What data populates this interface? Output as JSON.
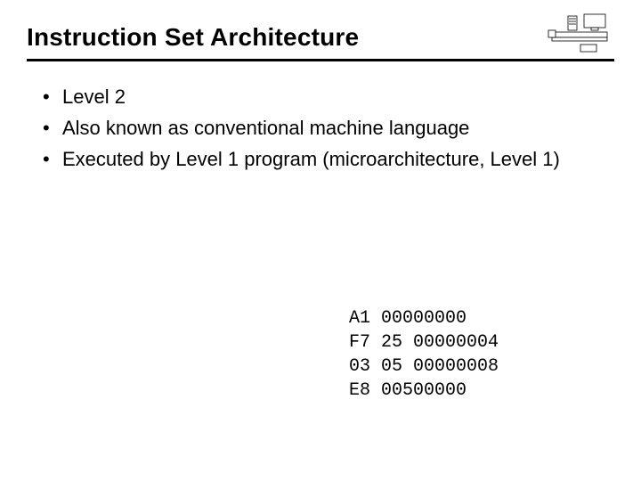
{
  "title": "Instruction Set Architecture",
  "bullets": [
    "Level 2",
    "Also known as conventional machine language",
    "Executed by Level 1 program (microarchitecture, Level 1)"
  ],
  "code_lines": [
    "A1 00000000",
    "F7 25 00000004",
    "03 05 00000008",
    "E8 00500000"
  ]
}
